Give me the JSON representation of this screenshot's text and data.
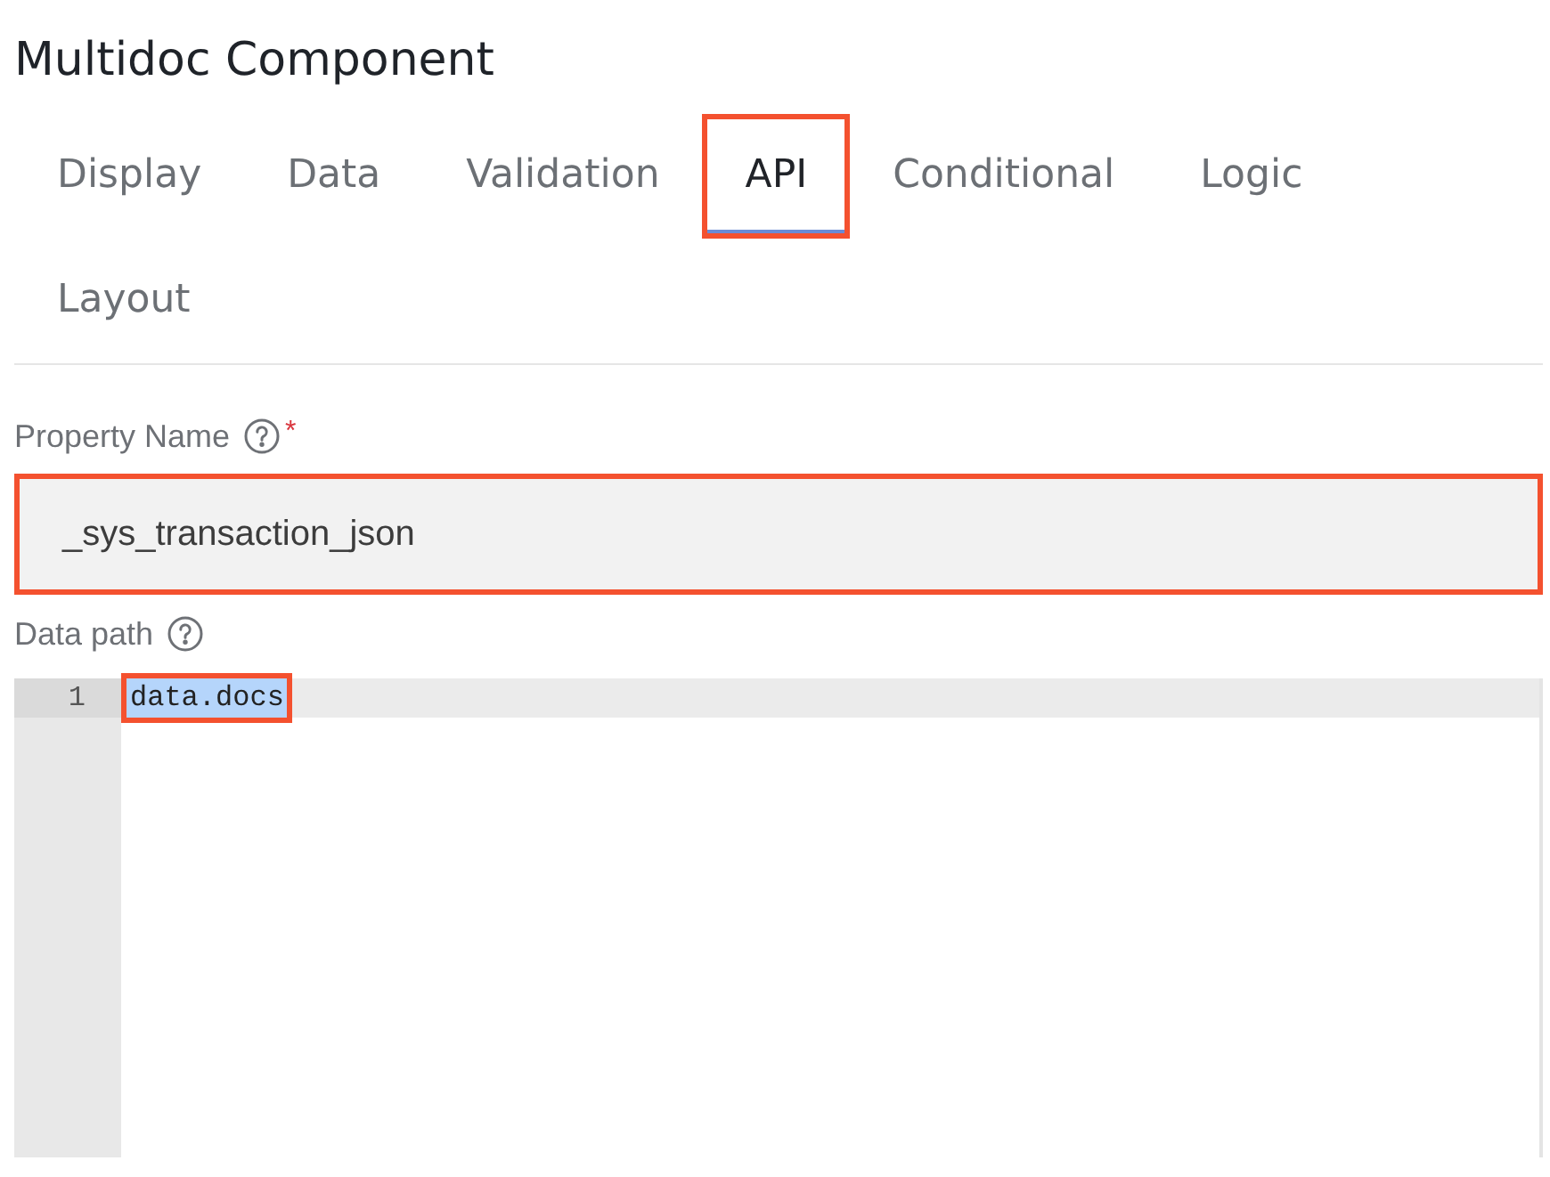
{
  "title": "Multidoc Component",
  "tabs": [
    {
      "label": "Display",
      "selected": false,
      "highlighted": false
    },
    {
      "label": "Data",
      "selected": false,
      "highlighted": false
    },
    {
      "label": "Validation",
      "selected": false,
      "highlighted": false
    },
    {
      "label": "API",
      "selected": true,
      "highlighted": true
    },
    {
      "label": "Conditional",
      "selected": false,
      "highlighted": false
    },
    {
      "label": "Logic",
      "selected": false,
      "highlighted": false
    },
    {
      "label": "Layout",
      "selected": false,
      "highlighted": false
    }
  ],
  "property_name": {
    "label": "Property Name",
    "required_mark": "*",
    "value": "_sys_transaction_json",
    "highlighted": true
  },
  "data_path": {
    "label": "Data path",
    "lines": [
      {
        "number": "1",
        "text": "data.docs",
        "selected": true,
        "highlighted": true
      }
    ]
  }
}
